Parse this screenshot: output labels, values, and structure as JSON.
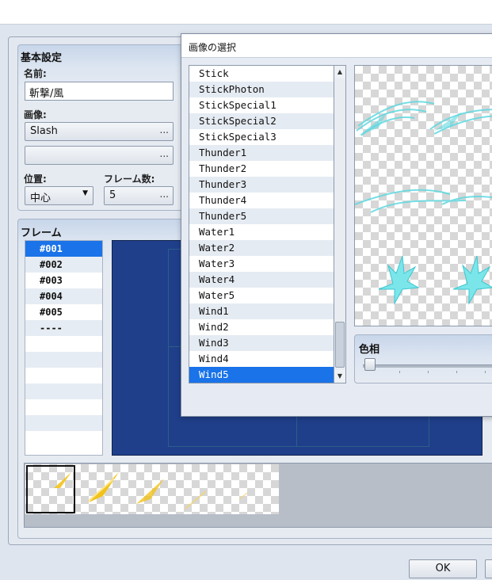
{
  "basic_settings": {
    "title": "基本設定",
    "name_label": "名前:",
    "name_value": "斬撃/風",
    "image_label": "画像:",
    "image1_value": "Slash",
    "image2_value": "",
    "position_label": "位置:",
    "position_value": "中心",
    "frames_label": "フレーム数:",
    "frames_value": "5",
    "dots": "..."
  },
  "frame_section": {
    "title": "フレーム",
    "items": [
      "#001",
      "#002",
      "#003",
      "#004",
      "#005",
      "----"
    ],
    "selected": "#001"
  },
  "dialog": {
    "title": "画像の選択",
    "files": [
      "Stick",
      "StickPhoton",
      "StickSpecial1",
      "StickSpecial2",
      "StickSpecial3",
      "Thunder1",
      "Thunder2",
      "Thunder3",
      "Thunder4",
      "Thunder5",
      "Water1",
      "Water2",
      "Water3",
      "Water4",
      "Water5",
      "Wind1",
      "Wind2",
      "Wind3",
      "Wind4",
      "Wind5"
    ],
    "selected_file": "Wind5",
    "hue_label": "色相",
    "hue_value": 0
  },
  "buttons": {
    "ok": "OK"
  },
  "colors": {
    "selection": "#1a73e8",
    "canvas": "#1f3f8a",
    "effect_cyan": "#5fd9e0",
    "effect_yellow": "#f2c21b"
  },
  "icons": {
    "dropdown": "chevron-down-icon",
    "scroll_up": "arrow-up-icon",
    "scroll_down": "arrow-down-icon"
  }
}
